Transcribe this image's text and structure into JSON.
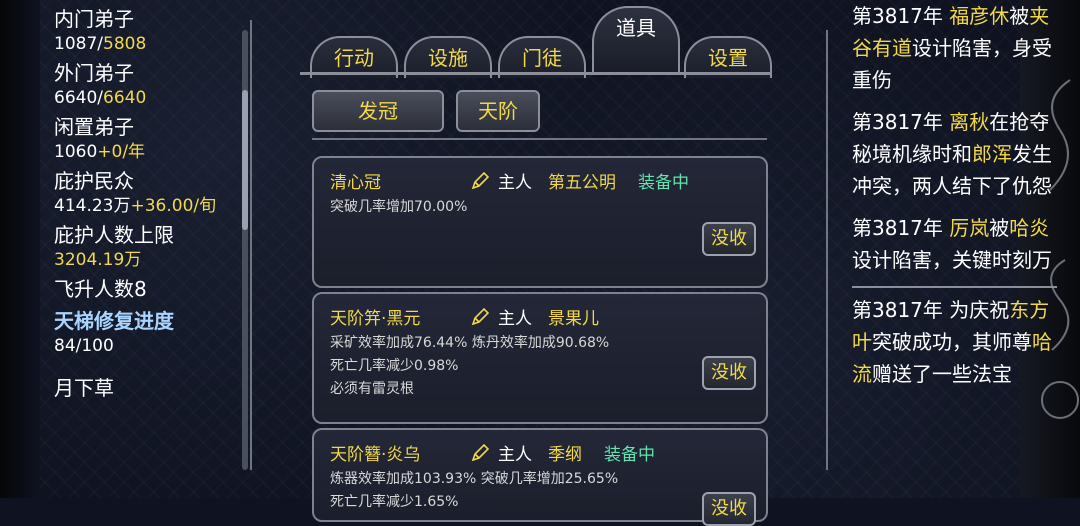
{
  "stats": {
    "inner_disciples_label": "内门弟子",
    "inner_current": "1087/",
    "inner_max": "5808",
    "outer_disciples_label": "外门弟子",
    "outer_current": "6640/",
    "outer_max": "6640",
    "idle_disciples_label": "闲置弟子",
    "idle_count": "1060",
    "idle_rate": "+0/年",
    "protected_people_label": "庇护民众",
    "protected_count": "414.23万",
    "protected_rate": "+36.00/旬",
    "protection_limit_label": "庇护人数上限",
    "protection_limit_value": "3204.19万",
    "ascension_label": "飞升人数8",
    "ladder_repair_label": "天梯修复进度",
    "ladder_repair_value": "84/100",
    "next_item_label": "月下草"
  },
  "tabs": [
    {
      "label": "行动"
    },
    {
      "label": "设施"
    },
    {
      "label": "门徒"
    },
    {
      "label": "道具",
      "active": true
    },
    {
      "label": "设置"
    }
  ],
  "subtabs": [
    {
      "label": "发冠"
    },
    {
      "label": "天阶"
    }
  ],
  "items": [
    {
      "name": "清心冠",
      "owner_label": "主人",
      "owner": "第五公明",
      "status": "装备中",
      "effects": [
        "突破几率增加70.00%"
      ],
      "action": "没收"
    },
    {
      "name": "天阶笄·黑元",
      "owner_label": "主人",
      "owner": "景果儿",
      "status": "",
      "effects": [
        "采矿效率加成76.44% 炼丹效率加成90.68%",
        "死亡几率减少0.98%",
        "必须有雷灵根"
      ],
      "action": "没收"
    },
    {
      "name": "天阶簪·炎乌",
      "owner_label": "主人",
      "owner": "季纲",
      "status": "装备中",
      "effects": [
        "炼器效率加成103.93% 突破几率增加25.65%",
        "死亡几率减少1.65%"
      ],
      "action": "没收"
    }
  ],
  "events": [
    {
      "year": "第3817年",
      "name1": "福彦休",
      "mid1": "被",
      "name2": "夹谷有道",
      "rest": "设计陷害，身受重伤"
    },
    {
      "year": "第3817年",
      "name1": "离秋",
      "mid1": "在抢夺秘境机缘时和",
      "name2": "郎浑",
      "rest": "发生冲突，两人结下了仇怨"
    },
    {
      "year": "第3817年",
      "name1": "厉岚",
      "mid1": "被",
      "name2": "哈炎",
      "rest": "设计陷害，关键时刻万剑山的郁诺"
    },
    {
      "year": "第3817年",
      "mid0": "为庆祝",
      "name1": "东方叶",
      "mid1": "突破成功，其师尊",
      "name2": "哈流",
      "rest": "赠送了一些法宝"
    }
  ],
  "colors": {
    "accent": "#f2d84a",
    "equipped": "#63e4ad",
    "highlight": "#a8d4ff"
  }
}
